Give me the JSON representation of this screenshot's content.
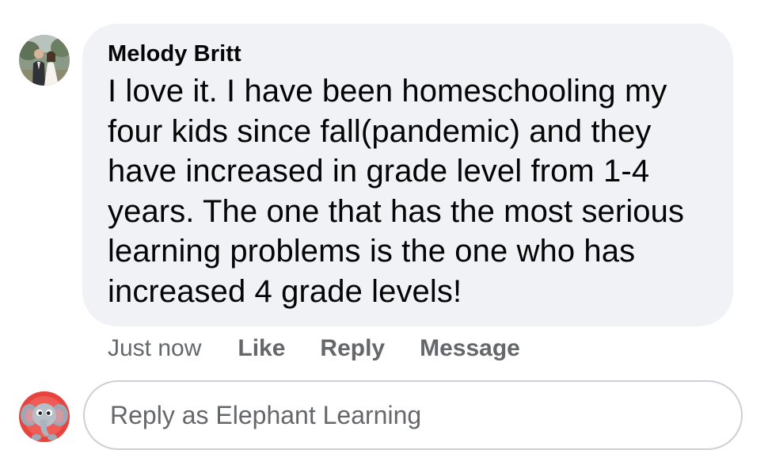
{
  "comment": {
    "author": "Melody Britt",
    "text": "I love it.  I have been homeschooling my\nfour kids since fall(pandemic) and they\nhave increased in grade level from 1-4\nyears.  The one that has the most serious\nlearning problems is the one who has\nincreased 4 grade levels!",
    "timestamp": "Just now",
    "actions": {
      "like": "Like",
      "reply": "Reply",
      "message": "Message"
    }
  },
  "reply_box": {
    "placeholder": "Reply as Elephant Learning",
    "value": ""
  },
  "colors": {
    "bubble_bg": "#f0f2f5",
    "text_primary": "#050505",
    "text_secondary": "#65676b",
    "input_border": "#ccd0d5"
  },
  "icons": {
    "commenter_avatar": "profile-photo",
    "self_avatar": "elephant-mascot"
  }
}
